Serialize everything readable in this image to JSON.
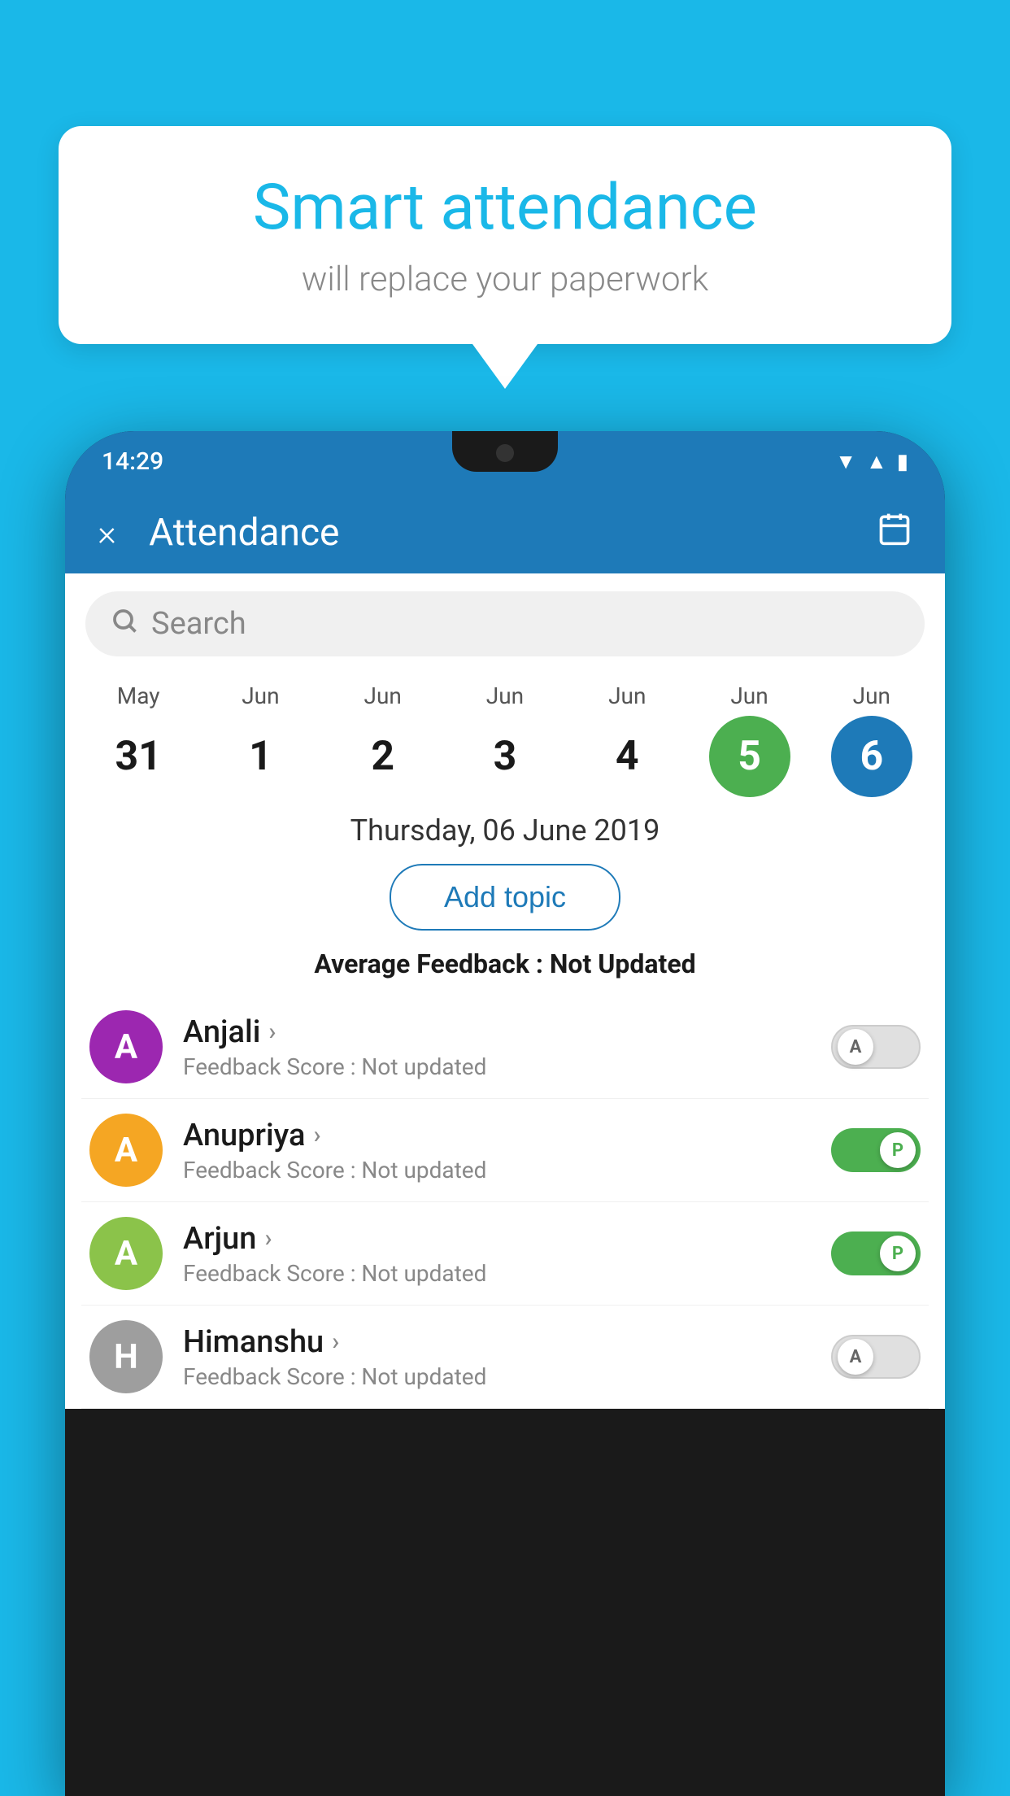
{
  "background_color": "#1ab8e8",
  "speech_bubble": {
    "title": "Smart attendance",
    "subtitle": "will replace your paperwork"
  },
  "phone": {
    "status_bar": {
      "time": "14:29",
      "icons": [
        "wifi",
        "signal",
        "battery"
      ]
    },
    "header": {
      "title": "Attendance",
      "close_label": "×",
      "calendar_icon": "📅"
    },
    "search": {
      "placeholder": "Search"
    },
    "calendar": {
      "dates": [
        {
          "month": "May",
          "day": "31",
          "state": "normal"
        },
        {
          "month": "Jun",
          "day": "1",
          "state": "normal"
        },
        {
          "month": "Jun",
          "day": "2",
          "state": "normal"
        },
        {
          "month": "Jun",
          "day": "3",
          "state": "normal"
        },
        {
          "month": "Jun",
          "day": "4",
          "state": "normal"
        },
        {
          "month": "Jun",
          "day": "5",
          "state": "today"
        },
        {
          "month": "Jun",
          "day": "6",
          "state": "selected"
        }
      ],
      "selected_date_label": "Thursday, 06 June 2019"
    },
    "add_topic_label": "Add topic",
    "avg_feedback_label": "Average Feedback :",
    "avg_feedback_value": "Not Updated",
    "students": [
      {
        "name": "Anjali",
        "avatar_letter": "A",
        "avatar_color": "#9c27b0",
        "feedback": "Feedback Score : Not updated",
        "toggle_state": "off",
        "toggle_letter": "A"
      },
      {
        "name": "Anupriya",
        "avatar_letter": "A",
        "avatar_color": "#f5a623",
        "feedback": "Feedback Score : Not updated",
        "toggle_state": "on",
        "toggle_letter": "P"
      },
      {
        "name": "Arjun",
        "avatar_letter": "A",
        "avatar_color": "#8bc34a",
        "feedback": "Feedback Score : Not updated",
        "toggle_state": "on",
        "toggle_letter": "P"
      },
      {
        "name": "Himanshu",
        "avatar_letter": "H",
        "avatar_color": "#9e9e9e",
        "feedback": "Feedback Score : Not updated",
        "toggle_state": "off",
        "toggle_letter": "A"
      }
    ]
  }
}
